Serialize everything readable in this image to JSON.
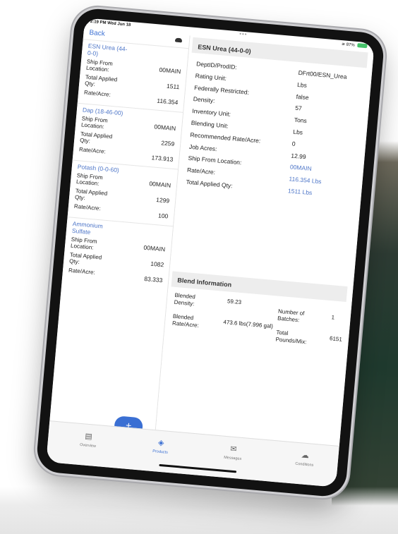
{
  "status": {
    "time": "2:19 PM  Wed Jun 18",
    "right": "87%"
  },
  "nav": {
    "back": "Back"
  },
  "icons": {
    "sync": "cloud-icon",
    "fab": "plus-icon"
  },
  "products": [
    {
      "name": "ESN Urea (44-0-0)",
      "ship_label": "Ship From Location:",
      "ship": "00MAIN",
      "qty_label": "Total Applied Qty:",
      "qty": "1511",
      "rate_label": "Rate/Acre:",
      "rate": "116.354"
    },
    {
      "name": "Dap (18-46-00)",
      "ship_label": "Ship From Location:",
      "ship": "00MAIN",
      "qty_label": "Total Applied Qty:",
      "qty": "2259",
      "rate_label": "Rate/Acre:",
      "rate": "173.913"
    },
    {
      "name": "Potash (0-0-60)",
      "ship_label": "Ship From Location:",
      "ship": "00MAIN",
      "qty_label": "Total Applied Qty:",
      "qty": "1299",
      "rate_label": "Rate/Acre:",
      "rate": "100"
    },
    {
      "name": "Ammonium Sulfate",
      "ship_label": "Ship From Location:",
      "ship": "00MAIN",
      "qty_label": "Total Applied Qty:",
      "qty": "1082",
      "rate_label": "Rate/Acre:",
      "rate": "83.333"
    }
  ],
  "fab_label": "+",
  "detail": {
    "title": "ESN Urea (44-0-0)",
    "fields": [
      {
        "label": "DeptID/ProdID:",
        "value": "DFrt00/ESN_Urea"
      },
      {
        "label": "Rating Unit:",
        "value": "Lbs"
      },
      {
        "label": "Federally Restricted:",
        "value": "false"
      },
      {
        "label": "Density:",
        "value": "57"
      },
      {
        "label": "Inventory Unit:",
        "value": "Tons"
      },
      {
        "label": "Blending Unit:",
        "value": "Lbs"
      },
      {
        "label": "Recommended Rate/Acre:",
        "value": "0"
      },
      {
        "label": "Job Acres:",
        "value": "12.99"
      },
      {
        "label": "Ship From Location:",
        "value": "00MAIN"
      },
      {
        "label": "Rate/Acre:",
        "value": "116.354 Lbs"
      },
      {
        "label": "Total Applied Qty:",
        "value": "1511 Lbs"
      }
    ]
  },
  "blend": {
    "title": "Blend Information",
    "density_label": "Blended Density:",
    "density": "59.23",
    "rate_label": "Blended Rate/Acre:",
    "rate": "473.6 lbs(7.996 gal)",
    "batches_label": "Number of Batches:",
    "batches": "1",
    "pounds_label": "Total Pounds/Mix:",
    "pounds": "6151"
  },
  "tabs": [
    {
      "label": "Overview",
      "icon": "document-icon"
    },
    {
      "label": "Products",
      "icon": "boxes-icon"
    },
    {
      "label": "Messages",
      "icon": "envelope-icon"
    },
    {
      "label": "Conditions",
      "icon": "weather-icon"
    }
  ],
  "colors": {
    "accent": "#3a6fd3",
    "link": "#4e76c8",
    "bezel": "#121212"
  }
}
